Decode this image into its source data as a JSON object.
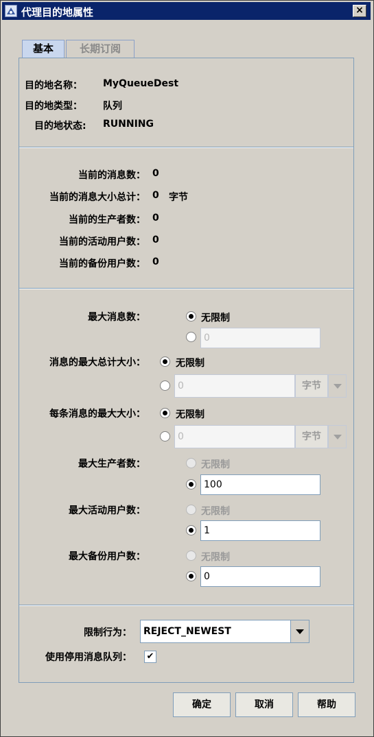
{
  "window": {
    "title": "代理目的地属性",
    "close_glyph": "×"
  },
  "tabs": [
    {
      "label": "基本",
      "active": true
    },
    {
      "label": "长期订阅",
      "active": false
    }
  ],
  "info": {
    "name_label": "目的地名称：",
    "name_value": "MyQueueDest",
    "type_label": "目的地类型：",
    "type_value": "队列",
    "state_label": "目的地状态:",
    "state_value": "RUNNING"
  },
  "stats": {
    "msg_count_label": "当前的消息数：",
    "msg_count_value": "0",
    "msg_size_label": "当前的消息大小总计：",
    "msg_size_value": "0",
    "msg_size_unit": "字节",
    "producers_label": "当前的生产者数：",
    "producers_value": "0",
    "active_consumers_label": "当前的活动用户数：",
    "active_consumers_value": "0",
    "backup_consumers_label": "当前的备份用户数：",
    "backup_consumers_value": "0"
  },
  "limits": {
    "max_messages": {
      "label": "最大消息数：",
      "unlimited_label": "无限制",
      "value": "0"
    },
    "max_total_size": {
      "label": "消息的最大总计大小：",
      "unlimited_label": "无限制",
      "value": "0",
      "unit": "字节"
    },
    "max_message_size": {
      "label": "每条消息的最大大小：",
      "unlimited_label": "无限制",
      "value": "0",
      "unit": "字节"
    },
    "max_producers": {
      "label": "最大生产者数：",
      "unlimited_label": "无限制",
      "value": "100"
    },
    "max_active_consumers": {
      "label": "最大活动用户数：",
      "unlimited_label": "无限制",
      "value": "1"
    },
    "max_backup_consumers": {
      "label": "最大备份用户数：",
      "unlimited_label": "无限制",
      "value": "0"
    }
  },
  "behavior": {
    "limit_label": "限制行为：",
    "limit_value": "REJECT_NEWEST",
    "dmq_label": "使用停用消息队列：",
    "dmq_checked": "✔"
  },
  "buttons": {
    "ok": "确定",
    "cancel": "取消",
    "help": "帮助"
  },
  "colors": {
    "titlebar": "#0a246a",
    "window_bg": "#d4d0c8",
    "border_blue": "#7f9db9"
  }
}
